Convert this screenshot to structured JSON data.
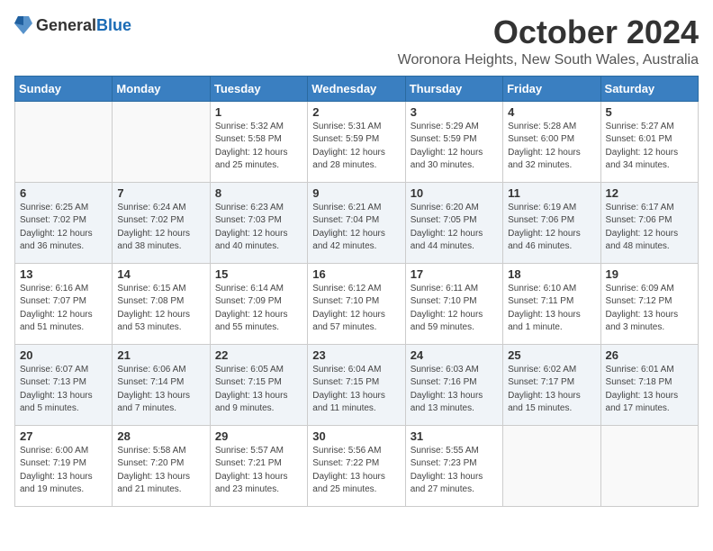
{
  "logo": {
    "general": "General",
    "blue": "Blue"
  },
  "title": "October 2024",
  "location": "Woronora Heights, New South Wales, Australia",
  "days_of_week": [
    "Sunday",
    "Monday",
    "Tuesday",
    "Wednesday",
    "Thursday",
    "Friday",
    "Saturday"
  ],
  "weeks": [
    [
      {
        "day": "",
        "info": ""
      },
      {
        "day": "",
        "info": ""
      },
      {
        "day": "1",
        "info": "Sunrise: 5:32 AM\nSunset: 5:58 PM\nDaylight: 12 hours\nand 25 minutes."
      },
      {
        "day": "2",
        "info": "Sunrise: 5:31 AM\nSunset: 5:59 PM\nDaylight: 12 hours\nand 28 minutes."
      },
      {
        "day": "3",
        "info": "Sunrise: 5:29 AM\nSunset: 5:59 PM\nDaylight: 12 hours\nand 30 minutes."
      },
      {
        "day": "4",
        "info": "Sunrise: 5:28 AM\nSunset: 6:00 PM\nDaylight: 12 hours\nand 32 minutes."
      },
      {
        "day": "5",
        "info": "Sunrise: 5:27 AM\nSunset: 6:01 PM\nDaylight: 12 hours\nand 34 minutes."
      }
    ],
    [
      {
        "day": "6",
        "info": "Sunrise: 6:25 AM\nSunset: 7:02 PM\nDaylight: 12 hours\nand 36 minutes."
      },
      {
        "day": "7",
        "info": "Sunrise: 6:24 AM\nSunset: 7:02 PM\nDaylight: 12 hours\nand 38 minutes."
      },
      {
        "day": "8",
        "info": "Sunrise: 6:23 AM\nSunset: 7:03 PM\nDaylight: 12 hours\nand 40 minutes."
      },
      {
        "day": "9",
        "info": "Sunrise: 6:21 AM\nSunset: 7:04 PM\nDaylight: 12 hours\nand 42 minutes."
      },
      {
        "day": "10",
        "info": "Sunrise: 6:20 AM\nSunset: 7:05 PM\nDaylight: 12 hours\nand 44 minutes."
      },
      {
        "day": "11",
        "info": "Sunrise: 6:19 AM\nSunset: 7:06 PM\nDaylight: 12 hours\nand 46 minutes."
      },
      {
        "day": "12",
        "info": "Sunrise: 6:17 AM\nSunset: 7:06 PM\nDaylight: 12 hours\nand 48 minutes."
      }
    ],
    [
      {
        "day": "13",
        "info": "Sunrise: 6:16 AM\nSunset: 7:07 PM\nDaylight: 12 hours\nand 51 minutes."
      },
      {
        "day": "14",
        "info": "Sunrise: 6:15 AM\nSunset: 7:08 PM\nDaylight: 12 hours\nand 53 minutes."
      },
      {
        "day": "15",
        "info": "Sunrise: 6:14 AM\nSunset: 7:09 PM\nDaylight: 12 hours\nand 55 minutes."
      },
      {
        "day": "16",
        "info": "Sunrise: 6:12 AM\nSunset: 7:10 PM\nDaylight: 12 hours\nand 57 minutes."
      },
      {
        "day": "17",
        "info": "Sunrise: 6:11 AM\nSunset: 7:10 PM\nDaylight: 12 hours\nand 59 minutes."
      },
      {
        "day": "18",
        "info": "Sunrise: 6:10 AM\nSunset: 7:11 PM\nDaylight: 13 hours\nand 1 minute."
      },
      {
        "day": "19",
        "info": "Sunrise: 6:09 AM\nSunset: 7:12 PM\nDaylight: 13 hours\nand 3 minutes."
      }
    ],
    [
      {
        "day": "20",
        "info": "Sunrise: 6:07 AM\nSunset: 7:13 PM\nDaylight: 13 hours\nand 5 minutes."
      },
      {
        "day": "21",
        "info": "Sunrise: 6:06 AM\nSunset: 7:14 PM\nDaylight: 13 hours\nand 7 minutes."
      },
      {
        "day": "22",
        "info": "Sunrise: 6:05 AM\nSunset: 7:15 PM\nDaylight: 13 hours\nand 9 minutes."
      },
      {
        "day": "23",
        "info": "Sunrise: 6:04 AM\nSunset: 7:15 PM\nDaylight: 13 hours\nand 11 minutes."
      },
      {
        "day": "24",
        "info": "Sunrise: 6:03 AM\nSunset: 7:16 PM\nDaylight: 13 hours\nand 13 minutes."
      },
      {
        "day": "25",
        "info": "Sunrise: 6:02 AM\nSunset: 7:17 PM\nDaylight: 13 hours\nand 15 minutes."
      },
      {
        "day": "26",
        "info": "Sunrise: 6:01 AM\nSunset: 7:18 PM\nDaylight: 13 hours\nand 17 minutes."
      }
    ],
    [
      {
        "day": "27",
        "info": "Sunrise: 6:00 AM\nSunset: 7:19 PM\nDaylight: 13 hours\nand 19 minutes."
      },
      {
        "day": "28",
        "info": "Sunrise: 5:58 AM\nSunset: 7:20 PM\nDaylight: 13 hours\nand 21 minutes."
      },
      {
        "day": "29",
        "info": "Sunrise: 5:57 AM\nSunset: 7:21 PM\nDaylight: 13 hours\nand 23 minutes."
      },
      {
        "day": "30",
        "info": "Sunrise: 5:56 AM\nSunset: 7:22 PM\nDaylight: 13 hours\nand 25 minutes."
      },
      {
        "day": "31",
        "info": "Sunrise: 5:55 AM\nSunset: 7:23 PM\nDaylight: 13 hours\nand 27 minutes."
      },
      {
        "day": "",
        "info": ""
      },
      {
        "day": "",
        "info": ""
      }
    ]
  ]
}
